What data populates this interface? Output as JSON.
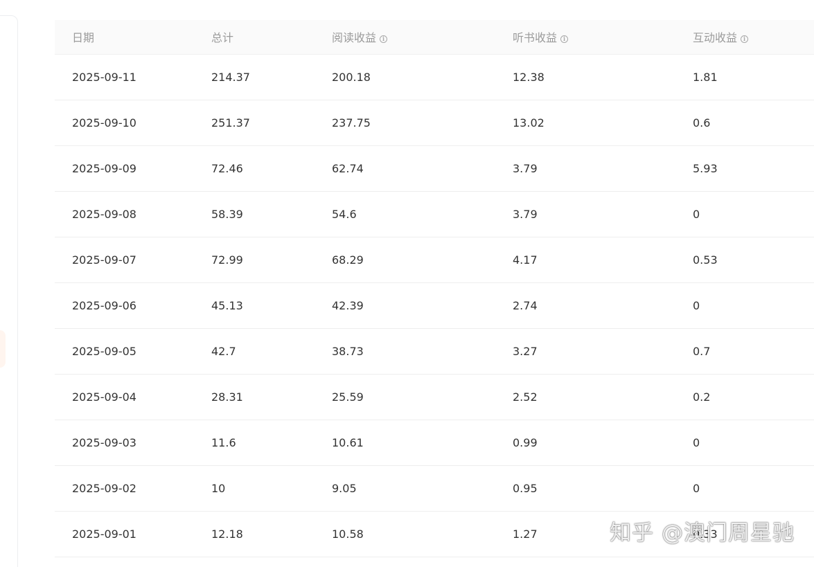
{
  "table": {
    "columns": [
      {
        "label": "日期",
        "has_info": false
      },
      {
        "label": "总计",
        "has_info": false
      },
      {
        "label": "阅读收益",
        "has_info": true
      },
      {
        "label": "听书收益",
        "has_info": true
      },
      {
        "label": "互动收益",
        "has_info": true
      }
    ],
    "info_icon_glyph": "i",
    "rows": [
      [
        "2025-09-11",
        "214.37",
        "200.18",
        "12.38",
        "1.81"
      ],
      [
        "2025-09-10",
        "251.37",
        "237.75",
        "13.02",
        "0.6"
      ],
      [
        "2025-09-09",
        "72.46",
        "62.74",
        "3.79",
        "5.93"
      ],
      [
        "2025-09-08",
        "58.39",
        "54.6",
        "3.79",
        "0"
      ],
      [
        "2025-09-07",
        "72.99",
        "68.29",
        "4.17",
        "0.53"
      ],
      [
        "2025-09-06",
        "45.13",
        "42.39",
        "2.74",
        "0"
      ],
      [
        "2025-09-05",
        "42.7",
        "38.73",
        "3.27",
        "0.7"
      ],
      [
        "2025-09-04",
        "28.31",
        "25.59",
        "2.52",
        "0.2"
      ],
      [
        "2025-09-03",
        "11.6",
        "10.61",
        "0.99",
        "0"
      ],
      [
        "2025-09-02",
        "10",
        "9.05",
        "0.95",
        "0"
      ],
      [
        "2025-09-01",
        "12.18",
        "10.58",
        "1.27",
        "0.33"
      ]
    ]
  },
  "watermark": "知乎 @澳门周星驰",
  "colors": {
    "header_bg": "#fafafa",
    "header_text": "#9b9b9b",
    "cell_text": "#333333",
    "divider": "#eeeeee"
  }
}
